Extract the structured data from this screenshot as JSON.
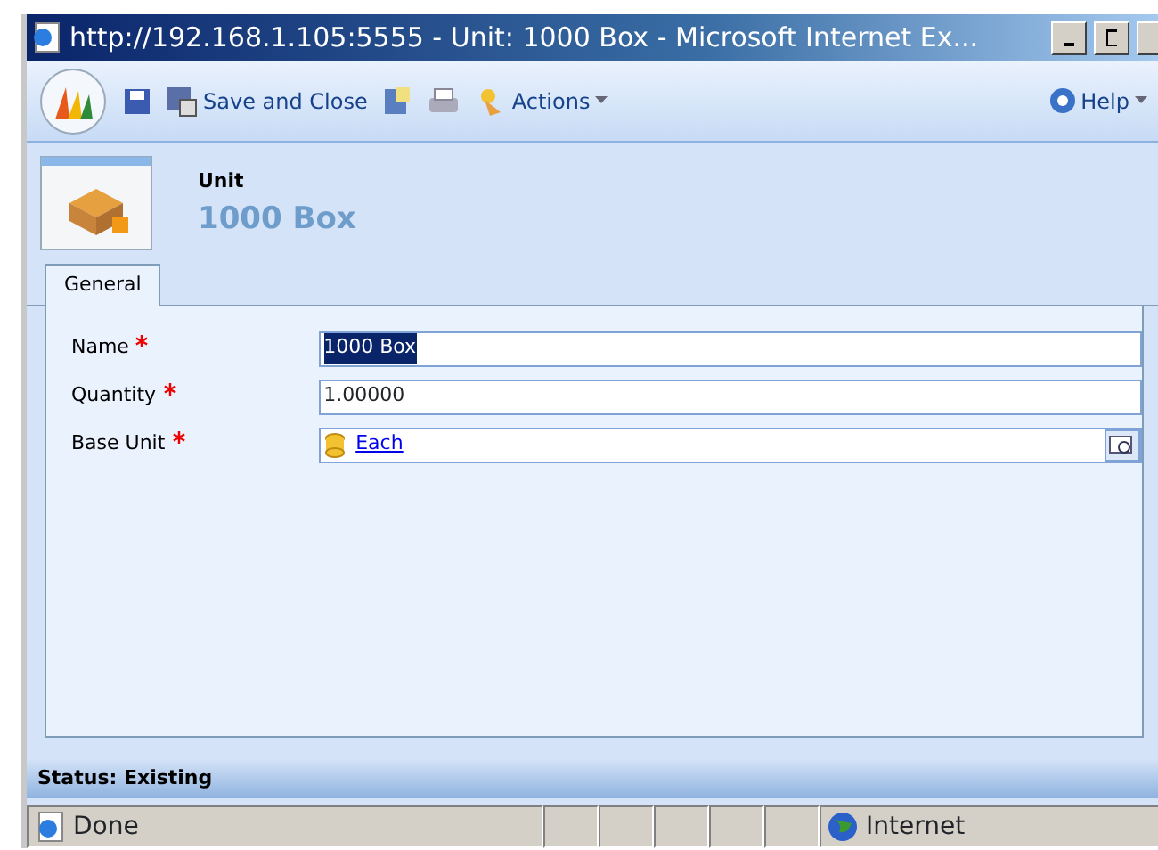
{
  "window": {
    "title": "http://192.168.1.105:5555 - Unit: 1000 Box - Microsoft Internet Ex..."
  },
  "toolbar": {
    "save_close": "Save and Close",
    "actions": "Actions",
    "help": "Help"
  },
  "header": {
    "entity": "Unit",
    "name": "1000 Box"
  },
  "tabs": [
    {
      "label": "General",
      "selected": true
    }
  ],
  "fields": [
    {
      "label": "Name",
      "required": true,
      "value": "1000 Box",
      "kind": "text",
      "text_selected": true
    },
    {
      "label": "Quantity",
      "required": true,
      "value": "1.00000",
      "kind": "text"
    },
    {
      "label": "Base Unit",
      "required": true,
      "value": "Each",
      "kind": "lookup"
    }
  ],
  "form_status": "Status: Existing",
  "browser_status": {
    "text": "Done",
    "zone": "Internet"
  }
}
